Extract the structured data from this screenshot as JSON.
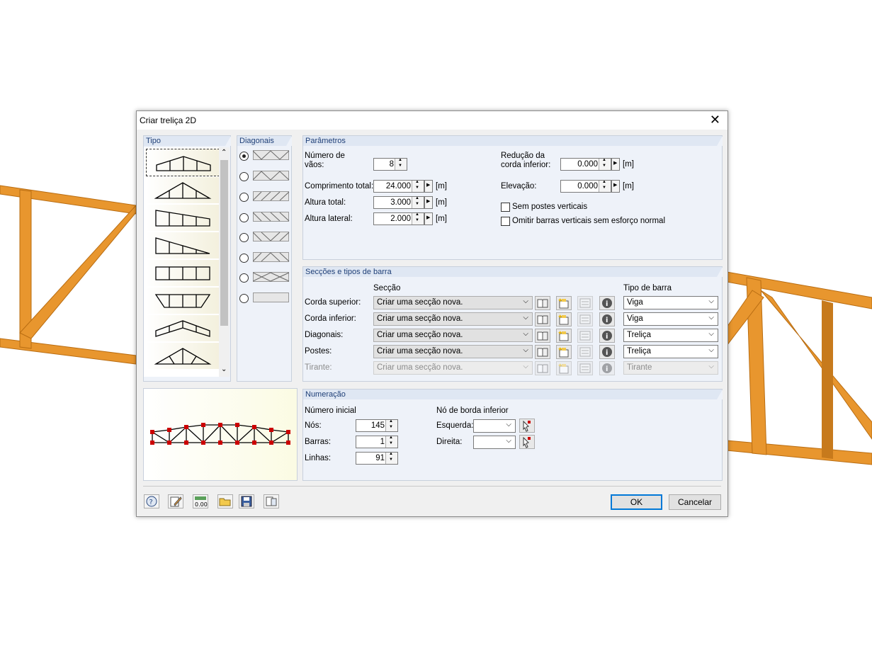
{
  "window": {
    "title": "Criar treliça 2D"
  },
  "type_panel": {
    "title": "Tipo",
    "item_count": 8,
    "selected_index": 0
  },
  "diagonals_panel": {
    "title": "Diagonais",
    "selected_index": 0,
    "option_count": 8
  },
  "parameters": {
    "title": "Parâmetros",
    "num_spans_label": "Número de\nvãos:",
    "num_spans": "8",
    "total_length_label": "Comprimento total:",
    "total_length": "24.000",
    "total_height_label": "Altura total:",
    "total_height": "3.000",
    "side_height_label": "Altura lateral:",
    "side_height": "2.000",
    "unit": "[m]",
    "lower_chord_reduction_label": "Redução da\ncorda inferior:",
    "lower_chord_reduction": "0.000",
    "elevation_label": "Elevação:",
    "elevation": "0.000",
    "no_vertical_posts_label": "Sem postes verticais",
    "no_vertical_posts_checked": false,
    "omit_vertical_bars_label": "Omitir barras verticais sem esforço normal",
    "omit_vertical_bars_checked": false
  },
  "sections": {
    "title": "Secções e tipos de barra",
    "section_header": "Secção",
    "bar_type_header": "Tipo de barra",
    "rows": [
      {
        "label": "Corda superior:",
        "section": "Criar uma secção nova.",
        "bar_type": "Viga",
        "enabled": true
      },
      {
        "label": "Corda inferior:",
        "section": "Criar uma secção nova.",
        "bar_type": "Viga",
        "enabled": true
      },
      {
        "label": "Diagonais:",
        "section": "Criar uma secção nova.",
        "bar_type": "Treliça",
        "enabled": true
      },
      {
        "label": "Postes:",
        "section": "Criar uma secção nova.",
        "bar_type": "Treliça",
        "enabled": true
      },
      {
        "label": "Tirante:",
        "section": "Criar uma secção nova.",
        "bar_type": "Tirante",
        "enabled": false
      }
    ]
  },
  "numbering": {
    "title": "Numeração",
    "start_number_label": "Número inicial",
    "nodes_label": "Nós:",
    "nodes": "145",
    "bars_label": "Barras:",
    "bars": "1",
    "lines_label": "Linhas:",
    "lines": "91",
    "lower_edge_node_label": "Nó de borda inferior",
    "left_label": "Esquerda:",
    "left_value": "",
    "right_label": "Direita:",
    "right_value": ""
  },
  "footer": {
    "ok_label": "OK",
    "cancel_label": "Cancelar"
  },
  "colors": {
    "accent": "#0078d7",
    "panel_title": "#1f3f77",
    "beam": "#e8962e",
    "node": "#cc0000"
  }
}
